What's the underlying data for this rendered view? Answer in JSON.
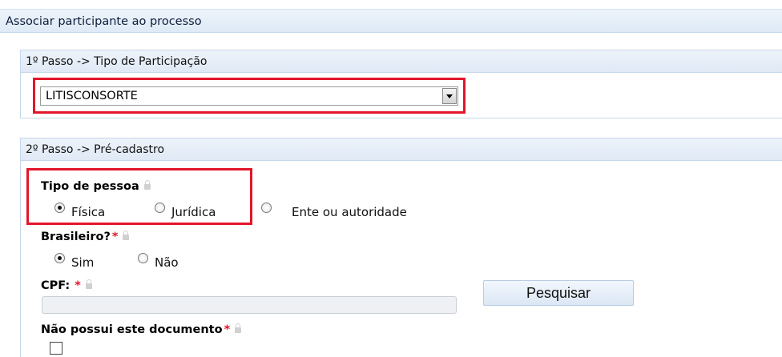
{
  "page": {
    "title": "Associar participante ao processo"
  },
  "step1": {
    "title": "1º Passo -> Tipo de Participação",
    "participation_type": {
      "selected": "LITISCONSORTE"
    }
  },
  "step2": {
    "title": "2º Passo -> Pré-cadastro",
    "person_type": {
      "label": "Tipo de pessoa",
      "options": [
        "Física",
        "Jurídica",
        "Ente ou autoridade"
      ],
      "selected": "Física"
    },
    "brazilian": {
      "label": "Brasileiro?",
      "required_mark": "*",
      "options": [
        "Sim",
        "Não"
      ],
      "selected": "Sim"
    },
    "cpf": {
      "label": "CPF:",
      "required_mark": "*",
      "value": ""
    },
    "search_button": "Pesquisar",
    "no_document": {
      "label": "Não possui este documento",
      "required_mark": "*",
      "checked": false
    }
  },
  "colors": {
    "highlight": "#e3162a",
    "panel_header": "#dfe9f5"
  }
}
